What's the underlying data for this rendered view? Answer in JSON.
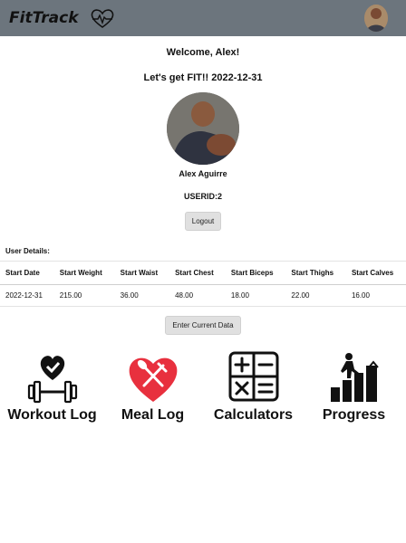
{
  "navbar": {
    "brand": "FitTrack",
    "logo_icon": "heart-ecg-icon"
  },
  "greeting": {
    "welcome": "Welcome, Alex!",
    "tagline": "Let's get FIT!! 2022-12-31"
  },
  "profile": {
    "name": "Alex Aguirre",
    "user_id": "USERID:2",
    "logout_label": "Logout"
  },
  "details": {
    "label": "User Details:",
    "headers": [
      "Start Date",
      "Start Weight",
      "Start Waist",
      "Start Chest",
      "Start Biceps",
      "Start Thighs",
      "Start Calves"
    ],
    "row": [
      "2022-12-31",
      "215.00",
      "36.00",
      "48.00",
      "18.00",
      "22.00",
      "16.00"
    ]
  },
  "enter_label": "Enter Current Data",
  "tiles": [
    {
      "label": "Workout Log",
      "icon": "dumbbell-heart-icon"
    },
    {
      "label": "Meal Log",
      "icon": "heart-fork-knife-icon"
    },
    {
      "label": "Calculators",
      "icon": "calculator-icon"
    },
    {
      "label": "Progress",
      "icon": "stairs-climber-icon"
    }
  ],
  "colors": {
    "navbar": "#6c757d",
    "meal_red": "#e8303e"
  }
}
